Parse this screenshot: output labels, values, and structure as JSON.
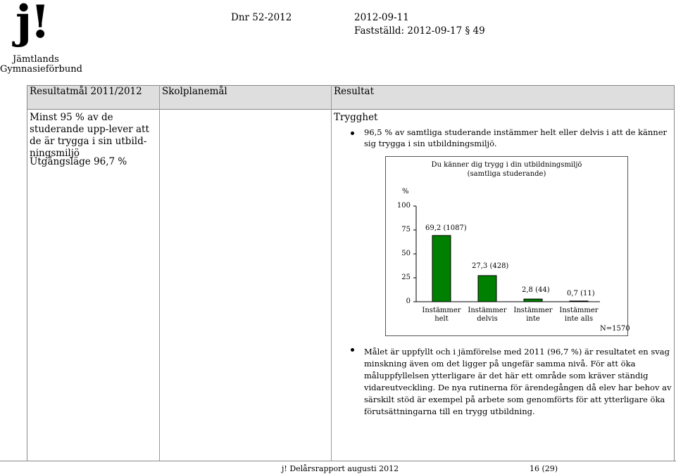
{
  "logo": {
    "mark": "j!",
    "line1": "Jämtlands",
    "line2": "Gymnasieförbund"
  },
  "header": {
    "dnr": "Dnr 52-2012",
    "date": "2012-09-11",
    "established": "Fastställd: 2012-09-17 § 49"
  },
  "table": {
    "col1": "Resultatmål 2011/2012",
    "col2": "Skolplanemål",
    "col3": "Resultat",
    "goal_text": "Minst 95 % av de studerande upp-lever att de är trygga i sin utbild-ningsmiljö",
    "baseline": "Utgångsläge 96,7 %",
    "result_heading": "Trygghet",
    "result_bullet1": "96,5 % av samtliga studerande instämmer helt eller delvis i att de känner sig trygga i sin utbildningsmiljö.",
    "result_bullet2": "Målet är uppfyllt och i jämförelse med 2011 (96,7 %) är resultatet en svag minskning även om det ligger på ungefär samma nivå. För att öka måluppfyllelsen ytterligare är det här ett område som kräver ständig vidareutveckling. De nya rutinerna för ärendegången då elev har behov av särskilt stöd är exempel på arbete som genomförts för att ytterligare öka förutsättningarna till en trygg utbildning."
  },
  "chart_data": {
    "type": "bar",
    "title": "Du känner dig trygg i din utbildningsmiljö",
    "subtitle": "(samtliga studerande)",
    "ylabel": "%",
    "ylim": [
      0,
      100
    ],
    "yticks": [
      "100",
      "75",
      "50",
      "25",
      "0"
    ],
    "categories": [
      "Instämmer helt",
      "Instämmer delvis",
      "Instämmer inte",
      "Instämmer inte alls"
    ],
    "values": [
      69.2,
      27.3,
      2.8,
      0.7
    ],
    "data_labels": [
      "69,2 (1087)",
      "27,3 (428)",
      "2,8 (44)",
      "0,7 (11)"
    ],
    "note": "N=1570",
    "bar_color": "#008000",
    "grid": false,
    "legend": "none"
  },
  "footer": {
    "left": "j! Delårsrapport augusti 2012",
    "right": "16 (29)"
  }
}
